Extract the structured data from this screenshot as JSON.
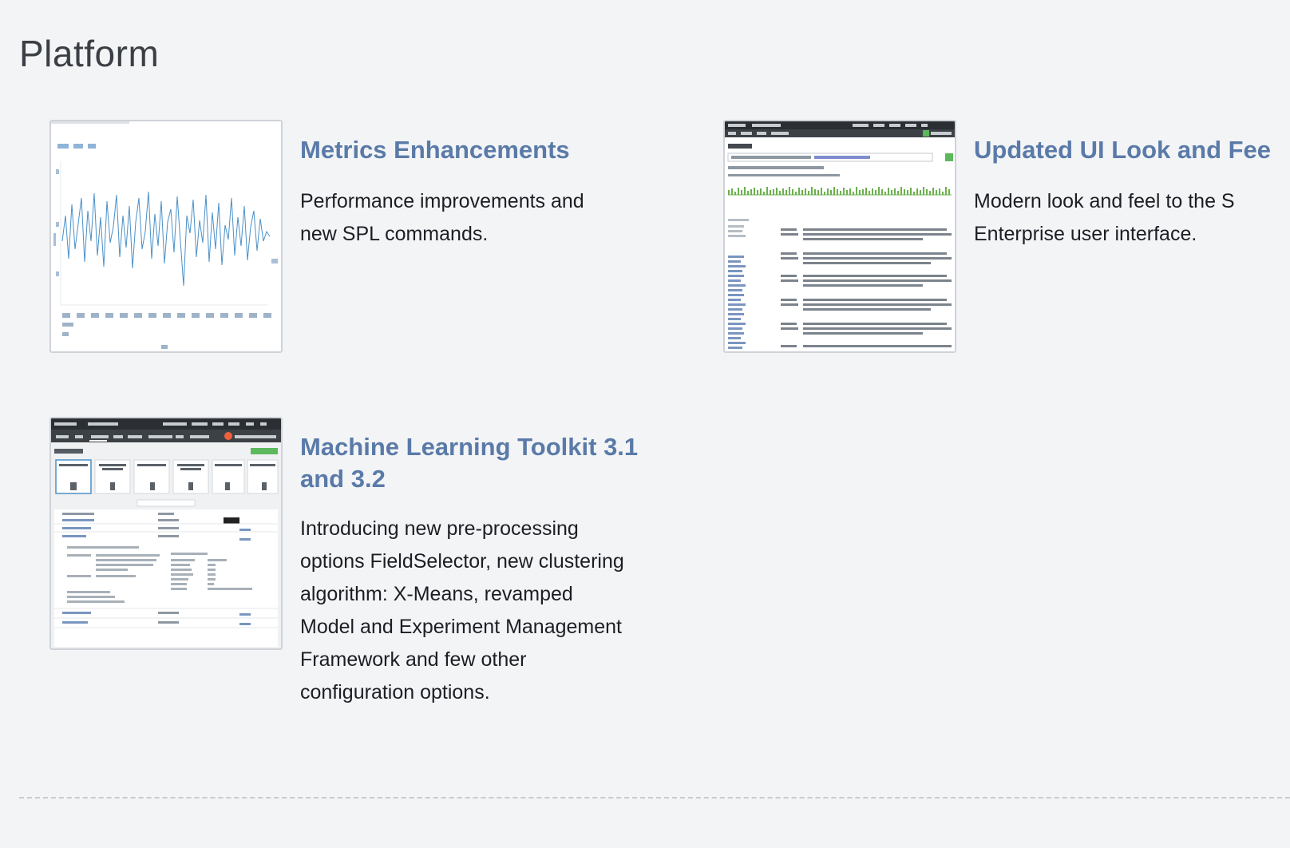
{
  "section": {
    "title": "Platform"
  },
  "features": [
    {
      "title": "Metrics Enhancements",
      "description_lines": [
        "Performance improvements and",
        "new SPL commands."
      ]
    },
    {
      "title": "Updated UI Look and Fee",
      "description_lines": [
        "Modern look and feel to the S",
        "Enterprise user interface."
      ]
    },
    {
      "title_lines": [
        "Machine Learning Toolkit 3.1",
        "and 3.2"
      ],
      "description_lines": [
        "Introducing new pre-processing",
        "options FieldSelector, new clustering",
        "algorithm: X-Means, revamped",
        "Model and Experiment Management",
        "Framework and few other",
        "configuration options."
      ]
    }
  ],
  "colors": {
    "background": "#f3f4f6",
    "feature_title": "#5a7aa8",
    "body_text": "#1b1f24",
    "section_title": "#3b3f45"
  }
}
